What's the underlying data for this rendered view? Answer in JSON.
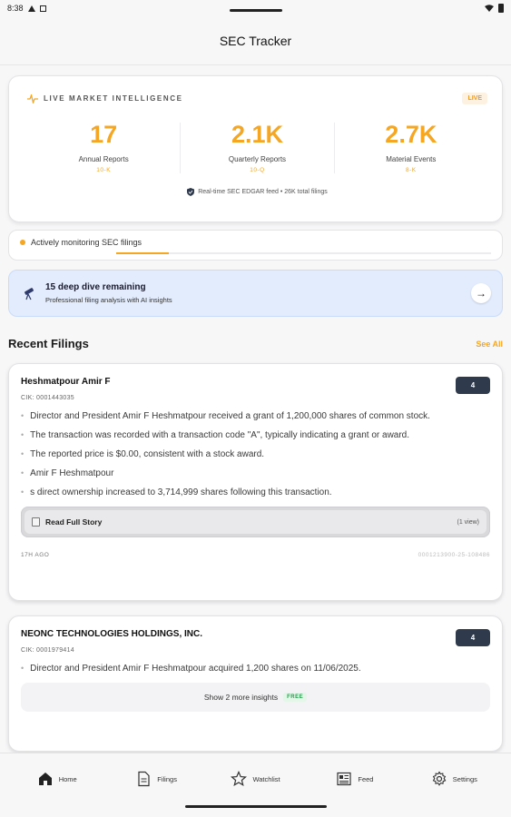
{
  "status": {
    "time": "8:38"
  },
  "app": {
    "title": "SEC Tracker"
  },
  "intel": {
    "title": "LIVE MARKET INTELLIGENCE",
    "badge": "LIVE",
    "stats": [
      {
        "value": "17",
        "label": "Annual Reports",
        "sub": "10-K"
      },
      {
        "value": "2.1K",
        "label": "Quarterly Reports",
        "sub": "10-Q"
      },
      {
        "value": "2.7K",
        "label": "Material Events",
        "sub": "8-K"
      }
    ],
    "feed_note": "Real-time SEC EDGAR feed • 26K total filings",
    "colors": {
      "accent": "#f5a623"
    }
  },
  "monitor": {
    "text": "Actively monitoring SEC filings",
    "progress": 0.14
  },
  "deepdive": {
    "title": "15 deep dive remaining",
    "subtitle": "Professional filing analysis with AI insights"
  },
  "recent": {
    "heading": "Recent Filings",
    "see_all": "See All"
  },
  "filings": [
    {
      "name": "Heshmatpour Amir F",
      "cik": "CIK: 0001443035",
      "count": "4",
      "bullets": [
        "Director and President Amir F Heshmatpour received a grant of 1,200,000 shares of common stock.",
        "The transaction was recorded with a transaction code \"A\", typically indicating a grant or award.",
        "The reported price is $0.00, consistent with a stock award.",
        "Amir F Heshmatpour",
        "s direct ownership increased to 3,714,999 shares following this transaction."
      ],
      "read_label": "Read Full Story",
      "views": "(1 view)",
      "age": "17H AGO",
      "accession": "0001213900-25-108486"
    },
    {
      "name": "NEONC TECHNOLOGIES HOLDINGS, INC.",
      "cik": "CIK: 0001979414",
      "count": "4",
      "bullets": [
        "Director and President Amir F Heshmatpour acquired 1,200 shares on 11/06/2025."
      ],
      "more_label": "Show 2 more insights",
      "free": "FREE"
    }
  ],
  "tabs": [
    {
      "label": "Home",
      "icon": "home-icon"
    },
    {
      "label": "Filings",
      "icon": "document-icon"
    },
    {
      "label": "Watchlist",
      "icon": "star-icon"
    },
    {
      "label": "Feed",
      "icon": "newspaper-icon"
    },
    {
      "label": "Settings",
      "icon": "gear-icon"
    }
  ]
}
